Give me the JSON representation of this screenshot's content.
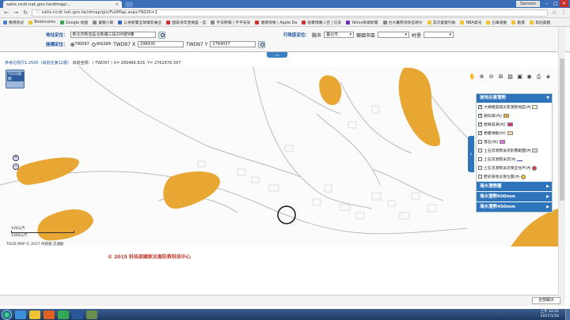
{
  "browser": {
    "tab_title": "satis.ncdr.nat.gov.tw/dmap/...",
    "user_badge": "Samson",
    "url": "satis.ncdr.nat.gov.tw/dmap/gis/FullMap.aspx?NGIS=1",
    "bookmarks": [
      {
        "label": "應用程式",
        "color": "#4a7fd0"
      },
      {
        "label": "Bookmarks",
        "color": "#f1c232"
      },
      {
        "label": "Google 地圖",
        "color": "#34a853"
      },
      {
        "label": "書籤小幫",
        "color": "#888888"
      },
      {
        "label": "公視新聞全球電影展全",
        "color": "#3366cc"
      },
      {
        "label": "國家清年音樂盛 - 哇",
        "color": "#cc3333"
      },
      {
        "label": "平安時報 | 平平安安",
        "color": "#888888"
      },
      {
        "label": "健康快樂 | Apple Da",
        "color": "#cc3333"
      },
      {
        "label": "福寶博購入吉 | 信安",
        "color": "#cc3333"
      },
      {
        "label": "Yahoo奇摩新聞",
        "color": "#6b2fb3"
      },
      {
        "label": "台大醫院消防官網文",
        "color": "#888888"
      },
      {
        "label": "其次書籤列表",
        "color": "#f1c232"
      },
      {
        "label": "NBA資訊",
        "color": "#f1c232"
      },
      {
        "label": "石筆運動",
        "color": "#f1c232"
      },
      {
        "label": "數量",
        "color": "#f1c232"
      },
      {
        "label": "其他書籤",
        "color": "#f1c232"
      }
    ]
  },
  "query": {
    "address_label": "地址定位：",
    "address_value": "新北市新店區北新路三段200號9樓",
    "admin_label": "行政區定位：",
    "county_label": "縣市",
    "county_value": "臺北市",
    "town_label": "鄉鎮市區",
    "village_label": "村里",
    "coord_label": "座標定位：",
    "radio_twd97": "TWD97",
    "radio_wgs84": "WGS84",
    "x_label": "TWD97 X",
    "x_value": "298435",
    "y_label": "TWD97 Y",
    "y_value": "2764037"
  },
  "status": {
    "scale_text": "參考比例尺1:2500（目前在第12層）",
    "coord_text": "目前坐標：( TWD97 ) X= 289466.829, Y= 2762876.397"
  },
  "map": {
    "basemap_label": "TGOS地圖",
    "scale_label": "100公尺",
    "scale_label2": "1000公尺",
    "copyright": "TGOS MAP © 2017 內政部,交通部",
    "hazard_color": "#e8a632"
  },
  "legend": {
    "header": "坡地災害潛勢",
    "items": [
      {
        "label": "大規模崩塌災害潛勢地區(內",
        "checked": true,
        "kind": "swatch",
        "color": "#fdf3c0"
      },
      {
        "label": "順向坡(內)",
        "checked": true,
        "kind": "swatch",
        "color": "#e8a632"
      },
      {
        "label": "岩屑崩滑(內)",
        "checked": true,
        "kind": "swatch",
        "color": "#d63384"
      },
      {
        "label": "岩體滑動(內)",
        "checked": true,
        "kind": "swatch",
        "color": "#f5d9a0"
      },
      {
        "label": "落石(內)",
        "checked": false,
        "kind": "swatch",
        "color": "#e070e0"
      },
      {
        "label": "土石流潛勢溪流影響範圍(內",
        "checked": false,
        "kind": "swatch",
        "color": "#dddddd"
      },
      {
        "label": "土石流潛勢溪流(內",
        "checked": false,
        "kind": "line",
        "color": "#3355cc"
      },
      {
        "label": "土石流潛勢溪流保全住戶(內",
        "checked": false,
        "kind": "icon",
        "color": "#e04040"
      },
      {
        "label": "歷史坡地災害位置(內",
        "checked": false,
        "kind": "icon",
        "color": "#f1c232"
      }
    ],
    "sections": [
      {
        "label": "淹水潛勢圖"
      },
      {
        "label": "淹水潛勢600mm"
      },
      {
        "label": "淹水潛勢450mm"
      }
    ]
  },
  "footer": {
    "text": "© 2015  科技部國家災害防救科技中心"
  },
  "downloads": {
    "show_all": "全部顯示"
  },
  "taskbar": {
    "time": "上午 12:02",
    "date": "2017/1/18",
    "apps": [
      {
        "name": "ie",
        "color": "#3c8fd8"
      },
      {
        "name": "explorer",
        "color": "#f1c232"
      },
      {
        "name": "media",
        "color": "#e06020"
      },
      {
        "name": "chrome",
        "color": "#34a853"
      },
      {
        "name": "word",
        "color": "#2b579a"
      },
      {
        "name": "photo",
        "color": "#6b8e4e"
      }
    ]
  }
}
